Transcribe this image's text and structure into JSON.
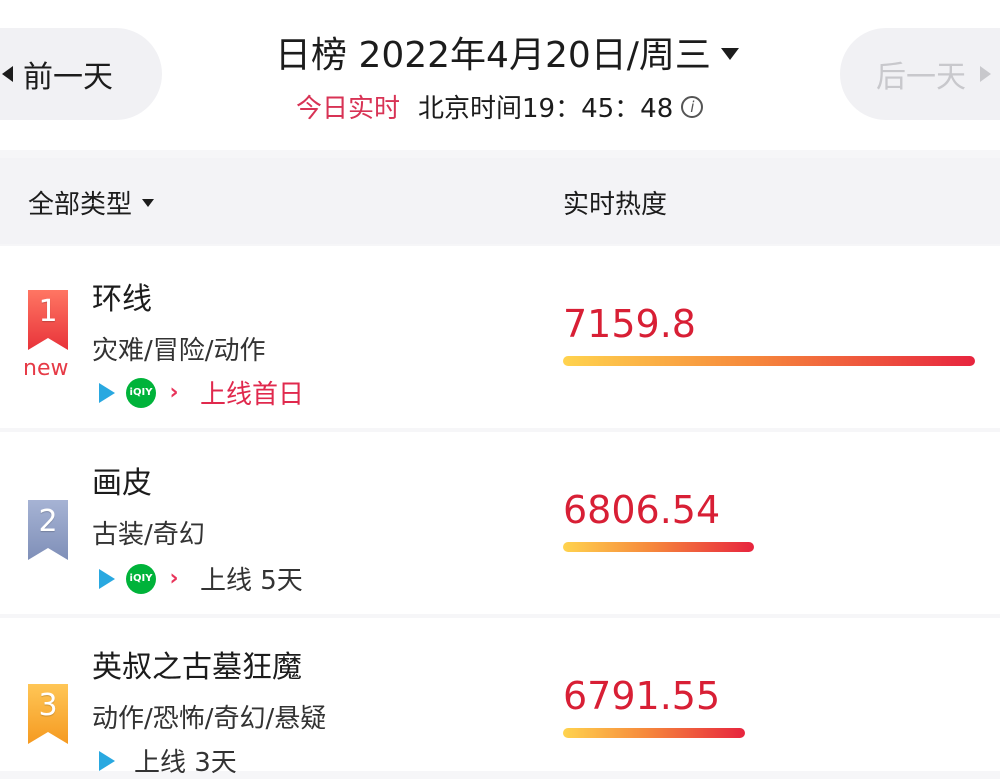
{
  "header": {
    "prev_label": "前一天",
    "next_label": "后一天",
    "title": "日榜 2022年4月20日/周三",
    "live_label": "今日实时",
    "clock": "北京时间19：45：48",
    "info_glyph": "i"
  },
  "columns": {
    "type_filter": "全部类型",
    "heat": "实时热度"
  },
  "rows": [
    {
      "rank": "1",
      "rank_color": "#e8333a",
      "tag": "new",
      "name": "环线",
      "genre": "灾难/冒险/动作",
      "platforms": [
        "tencent-video-icon",
        "iqiyi-icon",
        "youku-icon"
      ],
      "online": "上线首日",
      "heat": "7159.8",
      "heat_value": 7159.8
    },
    {
      "rank": "2",
      "rank_color": "#7f8fb8",
      "name": "画皮",
      "genre": "古装/奇幻",
      "platforms": [
        "tencent-video-icon",
        "iqiyi-icon",
        "youku-icon"
      ],
      "online": "上线 5天",
      "heat": "6806.54",
      "heat_value": 6806.54
    },
    {
      "rank": "3",
      "rank_color": "#f59a21",
      "name": "英叔之古墓狂魔",
      "genre": "动作/恐怖/奇幻/悬疑",
      "platforms": [
        "tencent-video-icon"
      ],
      "online": "上线 3天",
      "heat": "6791.55",
      "heat_value": 6791.55
    }
  ],
  "colors": {
    "accent": "#d83355",
    "heat_text": "#d81f35"
  }
}
